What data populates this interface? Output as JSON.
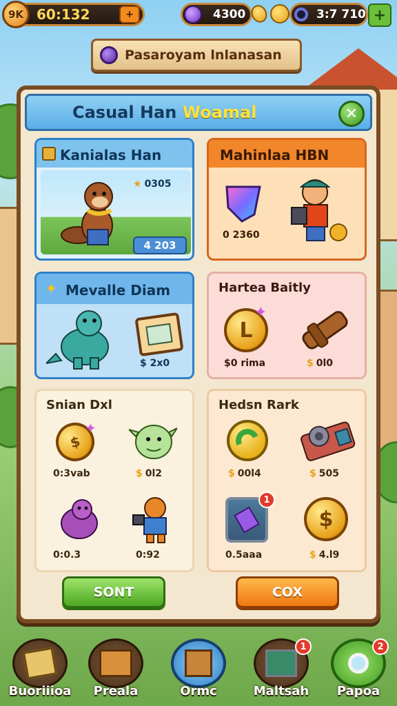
{
  "topbar": {
    "level_badge": "9K",
    "timer": "60:132",
    "plus_label": "+",
    "gems": "4300",
    "resource_ring": "0",
    "coins": "3:7 710",
    "add_label": "+"
  },
  "banner": {
    "text": "Pasaroyam lnlanasan"
  },
  "panel": {
    "title_part1": "Casual Han",
    "title_part2": "Woamal",
    "close_label": "✕",
    "cards": [
      {
        "title": "Kanialas Han",
        "price_top": "0305",
        "price_bottom": "4 203"
      },
      {
        "title": "Mahinlaa HBN",
        "price": "0 2360"
      },
      {
        "title": "Mevalle Diam",
        "price": "$ 2x0"
      },
      {
        "title": "Hartea Baitly",
        "price_left": "$0 rima",
        "price_right": "0l0"
      },
      {
        "title": "Snian Dxl",
        "prices": [
          "0:3vab",
          "0l2",
          "0:0.3",
          "0:92"
        ]
      },
      {
        "title": "Hedsn Rark",
        "prices": [
          "00l4",
          "505",
          "0.5aaa",
          "4.l9"
        ]
      }
    ],
    "buttons": {
      "left": "SONT",
      "right": "COX"
    }
  },
  "nav": {
    "items": [
      {
        "label": "Buoriiioa",
        "icon": "crate-icon",
        "badge": ""
      },
      {
        "label": "Preala",
        "icon": "box-icon",
        "badge": ""
      },
      {
        "label": "Ormc",
        "icon": "gift-box-icon",
        "badge": ""
      },
      {
        "label": "Maltsah",
        "icon": "chart-icon",
        "badge": "1"
      },
      {
        "label": "Papoa",
        "icon": "magnifier-icon",
        "badge": "2"
      }
    ]
  },
  "colors": {
    "panel_bg": "#f4e7cf",
    "frame": "#7a4c22",
    "accent_orange": "#f07812",
    "accent_green": "#4da822",
    "header_blue": "#5aaee6"
  }
}
